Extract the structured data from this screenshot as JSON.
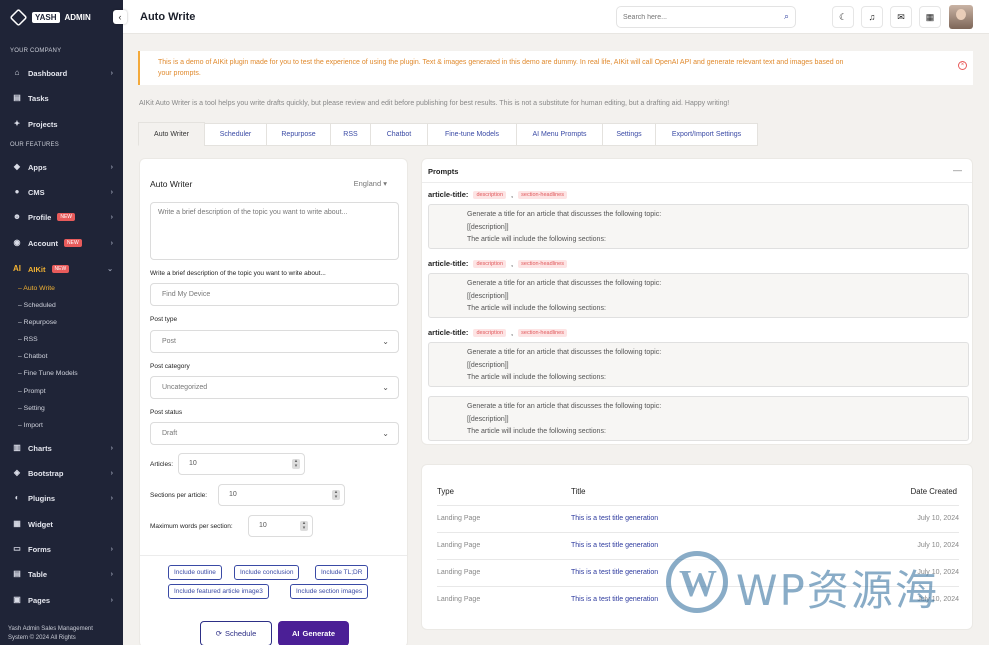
{
  "brand": {
    "badge": "YASH",
    "text": "ADMIN"
  },
  "sidebar": {
    "section1": "YOUR COMPANY",
    "dashboard": "Dashboard",
    "tasks": "Tasks",
    "projects": "Projects",
    "section2": "OUR FEATURES",
    "apps": "Apps",
    "cms": "CMS",
    "profile": "Profile",
    "account": "Account",
    "aikit": "AIKit",
    "new_badge": "NEW",
    "sub": [
      "Auto Write",
      "Scheduled",
      "Repurpose",
      "RSS",
      "Chatbot",
      "Fine Tune Models",
      "Prompt",
      "Setting",
      "Import"
    ],
    "charts": "Charts",
    "bootstrap": "Bootstrap",
    "plugins": "Plugins",
    "widget": "Widget",
    "forms": "Forms",
    "table": "Table",
    "pages": "Pages",
    "footer_line1": "Yash Admin Sales Management",
    "footer_line2": "System © 2024 All Rights"
  },
  "header": {
    "title": "Auto Write",
    "search_placeholder": "Search here..."
  },
  "notice": {
    "line1": "This is a demo of AIKit plugin made for you to test the experience of using the plugin. Text & images generated in this demo are dummy. In real life, AIKit will call OpenAI API and generate relevant text and images based on",
    "line2": "your prompts."
  },
  "intro": "AIKit Auto Writer is a tool helps you write drafts quickly, but please review and edit before publishing for best results. This is not a substitute for human editing, but a drafting aid. Happy writing!",
  "tabs": [
    "Auto Writer",
    "Scheduler",
    "Repurpose",
    "RSS",
    "Chatbot",
    "Fine-tune Models",
    "AI Menu Prompts",
    "Settings",
    "Export/Import Settings"
  ],
  "form": {
    "title": "Auto Writer",
    "language": "England",
    "topic_placeholder": "Write a brief description of the topic you want to write about...",
    "keywords_label": "Write a brief description of the topic you want to write about...",
    "keywords_placeholder": "Find My Device",
    "post_type_label": "Post type",
    "post_type_value": "Post",
    "post_category_label": "Post category",
    "post_category_value": "Uncategorized",
    "post_status_label": "Post status",
    "post_status_value": "Draft",
    "articles_label": "Articles:",
    "articles_value": "10",
    "sections_label": "Sections per article:",
    "sections_value": "10",
    "words_label": "Maximum words per section:",
    "words_value": "10",
    "chips": [
      "Include outline",
      "Include conclusion",
      "Include TL;DR",
      "Include featured article image3",
      "Include section images"
    ],
    "schedule": "Schedule",
    "generate": "Generate"
  },
  "prompts": {
    "title": "Prompts",
    "items": [
      {
        "label": "article-title:",
        "tag1": "description",
        "tag2": "section-headlines",
        "l1": "Generate a title for an article that discusses the following topic:",
        "l2": "[[description]]",
        "l3": "The article will include the following sections:"
      },
      {
        "label": "article-title:",
        "tag1": "description",
        "tag2": "section-headlines",
        "l1": "Generate a title for an article that discusses the following topic:",
        "l2": "[[description]]",
        "l3": "The article will include the following sections:"
      },
      {
        "label": "article-title:",
        "tag1": "description",
        "tag2": "section-headlines",
        "l1": "Generate a title for an article that discusses the following topic:",
        "l2": "[[description]]",
        "l3": "The article will include the following sections:"
      },
      {
        "label": "",
        "l1": "Generate a title for an article that discusses the following topic:",
        "l2": "[[description]]",
        "l3": "The article will include the following sections:"
      }
    ]
  },
  "table": {
    "headers": {
      "type": "Type",
      "title": "Title",
      "date": "Date Created"
    },
    "rows": [
      {
        "type": "Landing Page",
        "title": "This is a test title generation",
        "date": "July 10, 2024"
      },
      {
        "type": "Landing Page",
        "title": "This is a test title generation",
        "date": "July 10, 2024"
      },
      {
        "type": "Landing Page",
        "title": "This is a test title generation",
        "date": "July 10, 2024"
      },
      {
        "type": "Landing Page",
        "title": "This is a test title generation",
        "date": "July 10, 2024"
      }
    ]
  },
  "watermark": "WP资源海",
  "colors": {
    "sidebar": "#1f2437",
    "accent": "#f2b233",
    "primary": "#4b1f96",
    "link": "#2d3a9e",
    "tag": "#e0585b"
  }
}
